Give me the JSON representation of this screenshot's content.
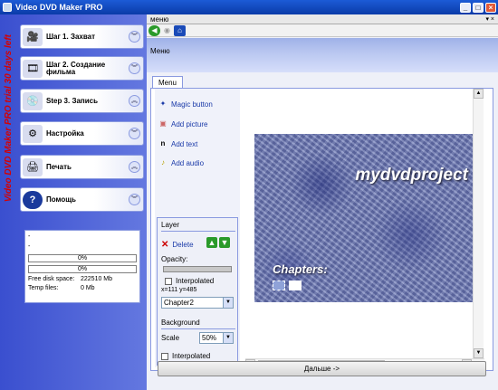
{
  "window": {
    "title": "Video DVD Maker PRO",
    "min": "_",
    "max": "□",
    "close": "×"
  },
  "sidebar": {
    "trial_text": "Video DVD Maker PRO trial 30 days left",
    "items": [
      {
        "label": "Шаг 1. Захват",
        "icon": "capture-icon"
      },
      {
        "label": "Шаг 2. Создание фильма",
        "icon": "film-reel-icon"
      },
      {
        "label": "Step 3. Запись",
        "icon": "disc-burner-icon"
      },
      {
        "label": "Настройка",
        "icon": "gear-icon"
      },
      {
        "label": "Печать",
        "icon": "printer-icon"
      },
      {
        "label": "Помощь",
        "icon": "help-icon"
      }
    ],
    "info": {
      "line1": "-",
      "line2": "-",
      "progress1": "0%",
      "progress2": "0%",
      "disk_label": "Free disk space:",
      "disk_value": "222510 Mb",
      "temp_label": "Temp files:",
      "temp_value": "0 Mb"
    }
  },
  "panel": {
    "header": "меню",
    "header_right": "▾ ×",
    "section_title": "Меню",
    "tab": "Menu"
  },
  "actions": {
    "magic": "Magic button",
    "picture": "Add picture",
    "text": "Add text",
    "audio": "Add audio"
  },
  "layer": {
    "title": "Layer",
    "delete": "Delete",
    "opacity": "Opacity:",
    "interpolated": "Interpolated",
    "coords": "x=111 y=485",
    "selected": "Chapter2"
  },
  "background": {
    "title": "Background",
    "scale_label": "Scale",
    "scale_value": "50%",
    "interpolated": "Interpolated"
  },
  "canvas": {
    "title": "mydvdproject",
    "chapters": "Chapters:"
  },
  "next_button": "Дальше ->"
}
